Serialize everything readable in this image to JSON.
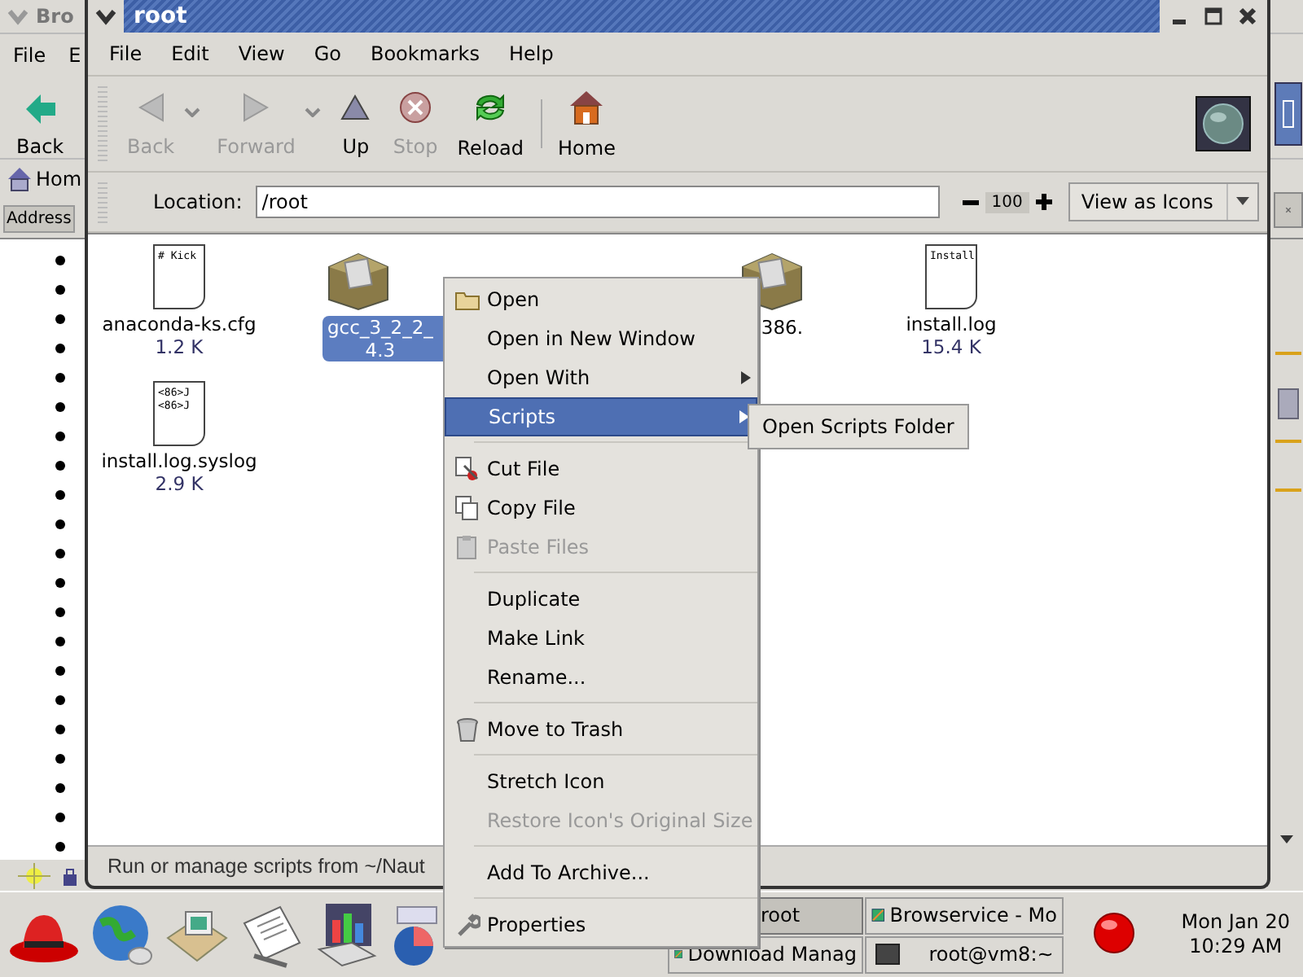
{
  "background_window": {
    "title": "Bro",
    "menu": [
      "File",
      "E"
    ],
    "back_label": "Back",
    "home_label": "Hom",
    "address_label": "Address"
  },
  "window": {
    "title": "root"
  },
  "menu": [
    "File",
    "Edit",
    "View",
    "Go",
    "Bookmarks",
    "Help"
  ],
  "toolbar": [
    {
      "label": "Back",
      "kind": "back",
      "disabled": true,
      "dropdown": true
    },
    {
      "label": "Forward",
      "kind": "forward",
      "disabled": true,
      "dropdown": true
    },
    {
      "label": "Up",
      "kind": "up",
      "disabled": false,
      "dropdown": false
    },
    {
      "label": "Stop",
      "kind": "stop",
      "disabled": true,
      "dropdown": false
    },
    {
      "label": "Reload",
      "kind": "reload",
      "disabled": false,
      "dropdown": false
    },
    {
      "label": "Home",
      "kind": "home",
      "disabled": false,
      "dropdown": false
    }
  ],
  "location": {
    "label": "Location:",
    "value": "/root",
    "zoom": "100",
    "view_mode": "View as Icons"
  },
  "files": [
    {
      "name": "anaconda-ks.cfg",
      "size": "1.2 K",
      "kind": "text",
      "preview": [
        "# Kick"
      ],
      "selected": false
    },
    {
      "name": "gcc_3_2_2_",
      "size": "4.3",
      "kind": "package",
      "selected": true,
      "covered_right": true
    },
    {
      "name": "386.",
      "kind": "package",
      "selected": false,
      "covered_left": true
    },
    {
      "name": "install.log",
      "size": "15.4 K",
      "kind": "text",
      "preview": [
        "Install"
      ],
      "selected": false
    },
    {
      "name": "install.log.syslog",
      "size": "2.9 K",
      "kind": "text",
      "preview": [
        "<86>J",
        "<86>J"
      ],
      "selected": false
    }
  ],
  "status_bar": "Run or manage scripts from ~/Naut",
  "context_menu": [
    {
      "kind": "folder",
      "label": "Open",
      "selected": false,
      "disabled": false,
      "submenu": false
    },
    {
      "kind": "plain",
      "label": "Open in New Window",
      "selected": false,
      "disabled": false,
      "submenu": false
    },
    {
      "kind": "plain",
      "label": "Open With",
      "selected": false,
      "disabled": false,
      "submenu": true
    },
    {
      "kind": "plain",
      "label": "Scripts",
      "selected": true,
      "disabled": false,
      "submenu": true
    },
    {
      "kind": "separator"
    },
    {
      "kind": "cut",
      "label": "Cut File",
      "selected": false,
      "disabled": false,
      "submenu": false
    },
    {
      "kind": "copy",
      "label": "Copy File",
      "selected": false,
      "disabled": false,
      "submenu": false
    },
    {
      "kind": "paste",
      "label": "Paste Files",
      "selected": false,
      "disabled": true,
      "submenu": false
    },
    {
      "kind": "separator"
    },
    {
      "kind": "plain",
      "label": "Duplicate",
      "selected": false,
      "disabled": false,
      "submenu": false
    },
    {
      "kind": "plain",
      "label": "Make Link",
      "selected": false,
      "disabled": false,
      "submenu": false
    },
    {
      "kind": "plain",
      "label": "Rename...",
      "selected": false,
      "disabled": false,
      "submenu": false
    },
    {
      "kind": "separator"
    },
    {
      "kind": "trash",
      "label": "Move to Trash",
      "selected": false,
      "disabled": false,
      "submenu": false
    },
    {
      "kind": "separator"
    },
    {
      "kind": "plain",
      "label": "Stretch Icon",
      "selected": false,
      "disabled": false,
      "submenu": false
    },
    {
      "kind": "plain",
      "label": "Restore Icon's Original Size",
      "selected": false,
      "disabled": true,
      "submenu": false
    },
    {
      "kind": "separator"
    },
    {
      "kind": "plain",
      "label": "Add To Archive...",
      "selected": false,
      "disabled": false,
      "submenu": false
    },
    {
      "kind": "separator"
    },
    {
      "kind": "wrench",
      "label": "Properties",
      "selected": false,
      "disabled": false,
      "submenu": false
    }
  ],
  "submenu": [
    "Open Scripts Folder"
  ],
  "taskbar": {
    "tasks": [
      {
        "label": "root",
        "kind": "plain",
        "selected": true
      },
      {
        "label": "Browservice - Mo",
        "kind": "browser",
        "selected": false
      },
      {
        "label": "Download Manag",
        "kind": "browser",
        "selected": false
      },
      {
        "label": "root@vm8:~",
        "kind": "terminal",
        "selected": false
      }
    ],
    "clock": {
      "date": "Mon Jan 20",
      "time": "10:29 AM"
    }
  }
}
